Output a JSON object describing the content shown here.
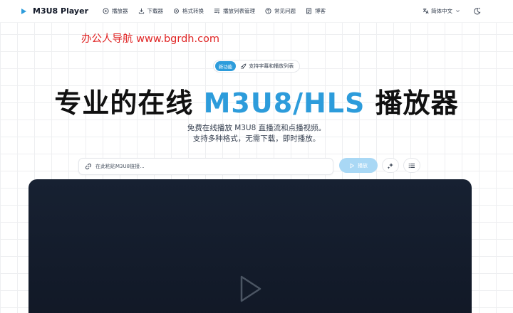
{
  "header": {
    "brand_name": "M3U8 Player",
    "nav": [
      {
        "label": "播放器",
        "icon": "play-circle-icon"
      },
      {
        "label": "下载器",
        "icon": "download-icon"
      },
      {
        "label": "格式转换",
        "icon": "gear-icon"
      },
      {
        "label": "播放列表管理",
        "icon": "playlist-icon"
      },
      {
        "label": "常见问题",
        "icon": "help-circle-icon"
      },
      {
        "label": "博客",
        "icon": "document-icon"
      }
    ],
    "language": "简体中文",
    "theme_icon": "moon-sparkle-icon"
  },
  "watermark": "办公人导航 www.bgrdh.com",
  "badge": {
    "tag": "新功能",
    "text": "支持字幕和播放列表",
    "icon": "rocket-icon"
  },
  "hero": {
    "title_part1": "专业的在线 ",
    "title_highlight": "M3U8/HLS",
    "title_part2": " 播放器",
    "subtitle_line1": "免费在线播放 M3U8 直播流和点播视频。",
    "subtitle_line2": "支持多种格式，无需下载，即时播放。"
  },
  "input": {
    "placeholder": "在此粘贴M3U8链接...",
    "value": "",
    "play_label": "播放"
  },
  "colors": {
    "accent": "#2d9cdb",
    "play_button": "#a9d8f5",
    "player_bg": "#151e2e",
    "watermark": "#e02424"
  }
}
